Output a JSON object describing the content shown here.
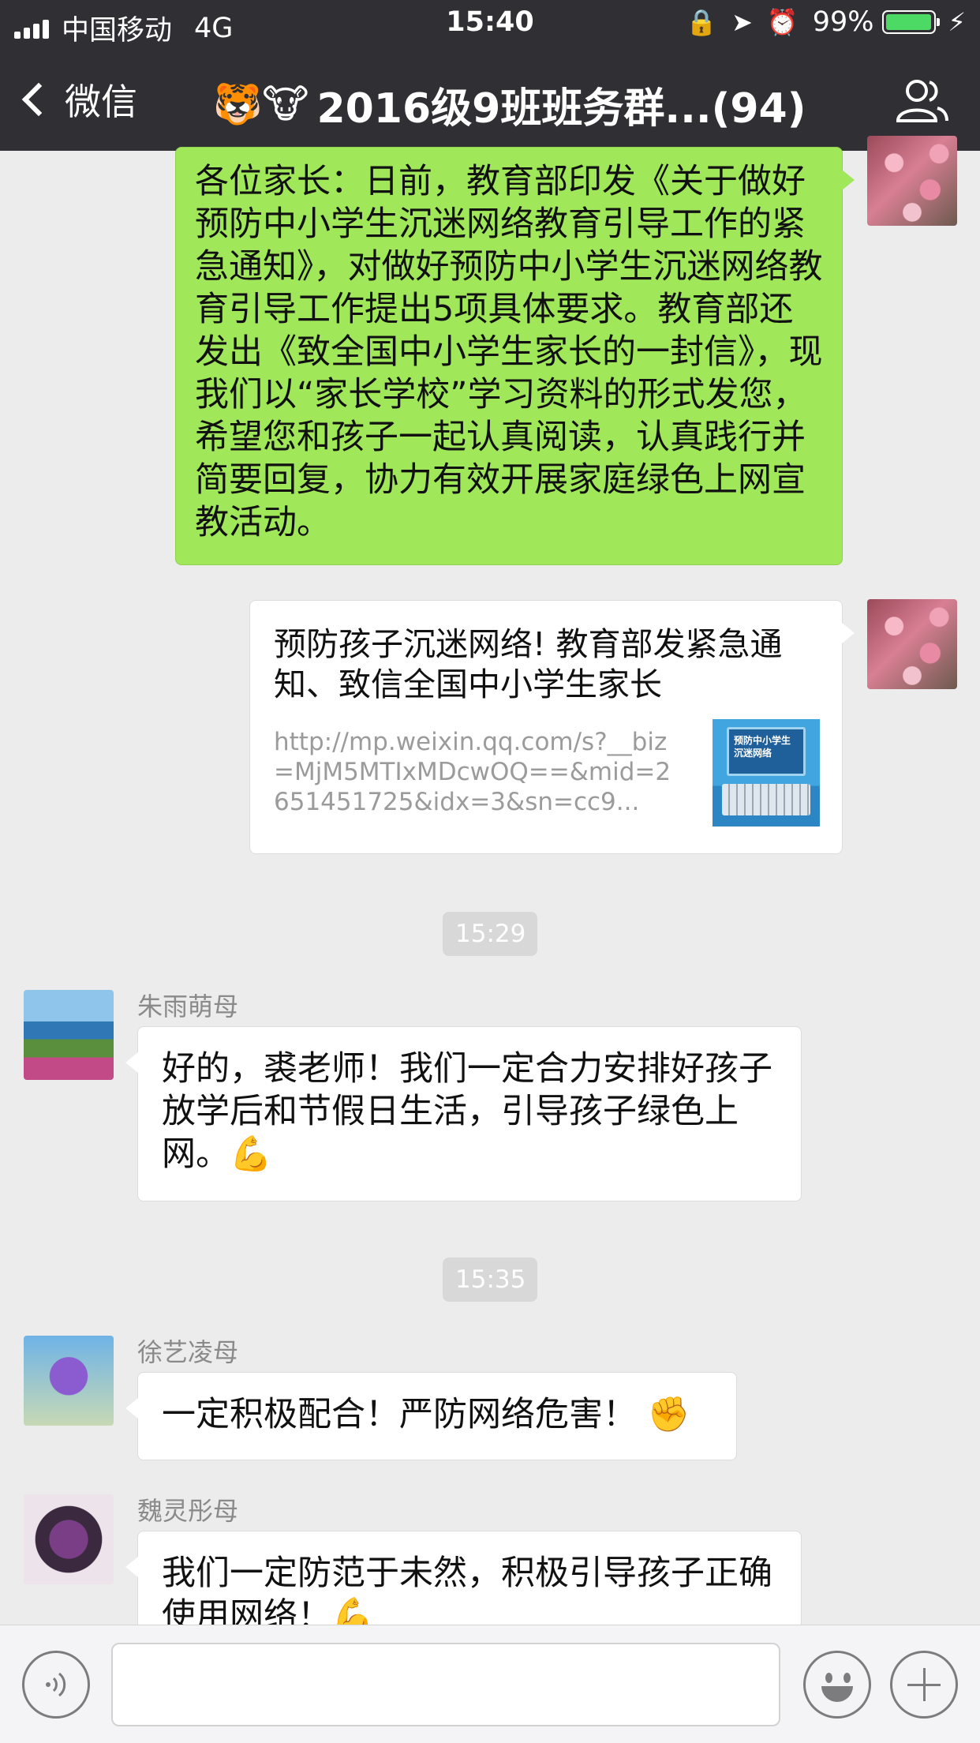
{
  "status_bar": {
    "carrier": "中国移动",
    "network": "4G",
    "time": "15:40",
    "battery": "99%",
    "battery_level": 0.99,
    "icons": [
      "orientation-lock-icon",
      "location-icon",
      "alarm-icon",
      "charging-icon"
    ]
  },
  "nav": {
    "back_label": "微信",
    "title_emojis": "🐯🐮",
    "title": "2016级9班班务群...(94)",
    "group_icon": "group-members-icon"
  },
  "messages": {
    "m1": {
      "text": "各位家长：日前，教育部印发《关于做好预防中小学生沉迷网络教育引导工作的紧急通知》，对做好预防中小学生沉迷网络教育引导工作提出5项具体要求。教育部还发出《致全国中小学生家长的一封信》，现我们以“家长学校”学习资料的形式发您，希望您和孩子一起认真阅读，认真践行并简要回复，协力有效开展家庭绿色上网宣教活动。"
    },
    "m2": {
      "title": "预防孩子沉迷网络! 教育部发紧急通知、致信全国中小学生家长",
      "url": "http://mp.weixin.qq.com/s?__biz=MjM5MTIxMDcwOQ==&mid=2651451725&idx=3&sn=cc9...",
      "thumb_text": "预防中小学生\n沉迷网络"
    },
    "t1": "15:29",
    "m3": {
      "sender": "朱雨萌母",
      "text": "好的，裘老师！我们一定合力安排好孩子放学后和节假日生活，引导孩子绿色上网。💪"
    },
    "t2": "15:35",
    "m4": {
      "sender": "徐艺凌母",
      "text": "一定积极配合！严防网络危害！ ✊"
    },
    "m5": {
      "sender": "魏灵彤母",
      "text": "我们一定防范于未然，积极引导孩子正确使用网络！💪"
    }
  },
  "input_bar": {
    "icons": [
      "voice-icon",
      "emoji-icon",
      "plus-icon"
    ]
  }
}
